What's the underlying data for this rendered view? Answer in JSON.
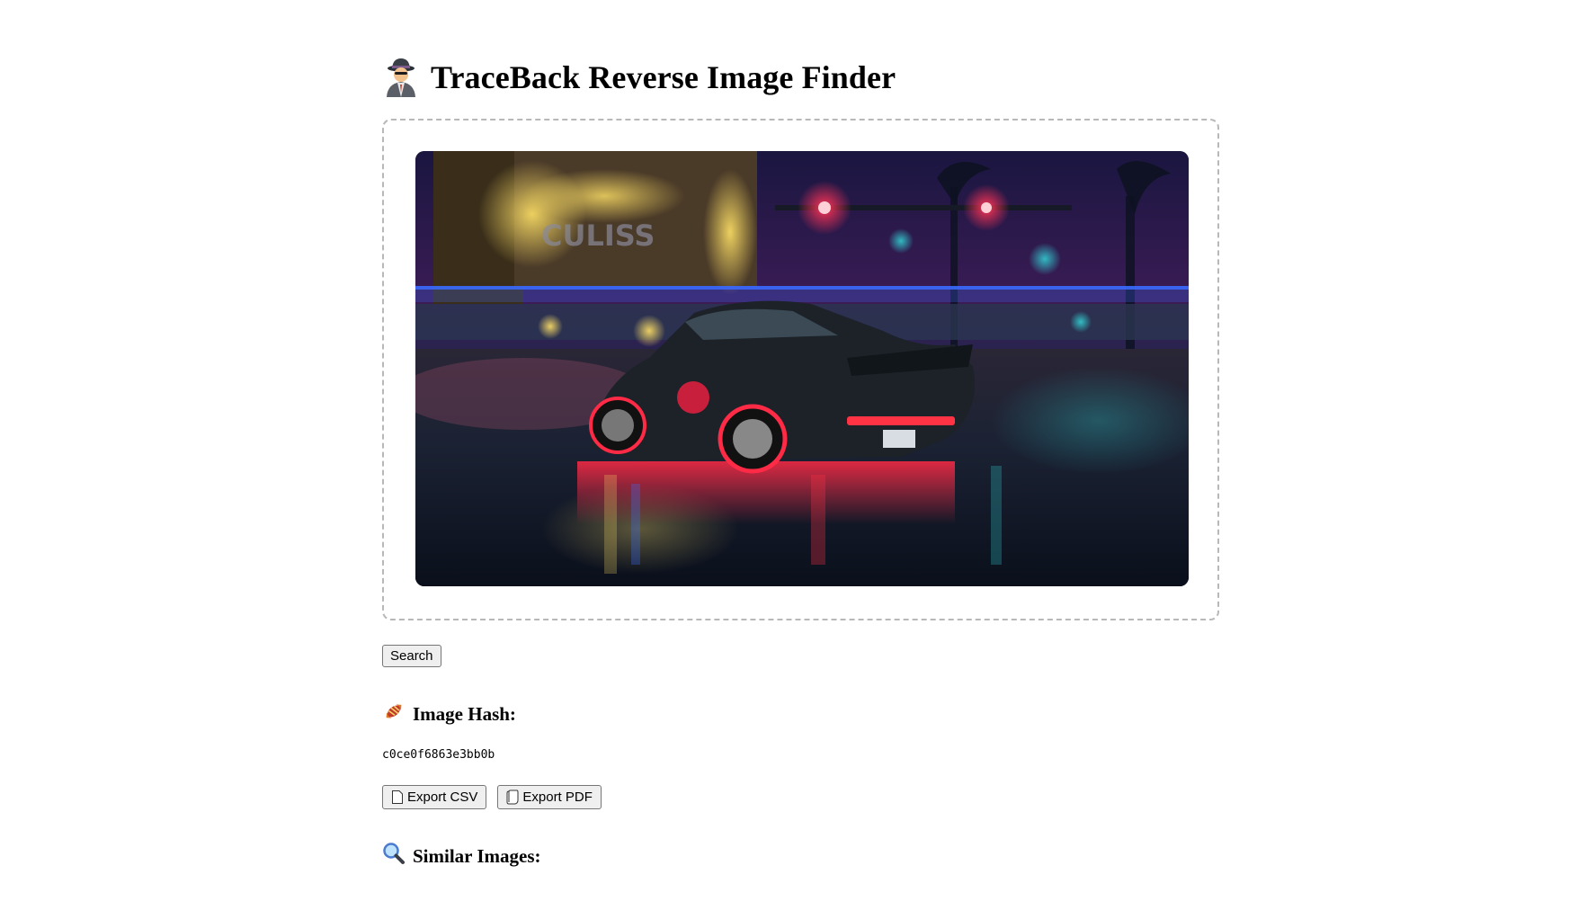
{
  "page": {
    "title": "TraceBack Reverse Image Finder",
    "title_icon": "spy-detective-icon"
  },
  "upload": {
    "preview_alt": "Uploaded image preview"
  },
  "search": {
    "button_label": "Search"
  },
  "hash": {
    "heading": "Image Hash:",
    "heading_icon": "candy-icon",
    "value": "c0ce0f6863e3bb0b"
  },
  "export": {
    "csv_label": "Export CSV",
    "csv_icon": "document-icon",
    "pdf_label": "Export PDF",
    "pdf_icon": "scroll-icon"
  },
  "similar": {
    "heading": "Similar Images:",
    "heading_icon": "magnifier-icon"
  },
  "colors": {
    "dashed_border": "#b8b8b8",
    "button_bg": "#efefef",
    "button_border": "#767676"
  }
}
